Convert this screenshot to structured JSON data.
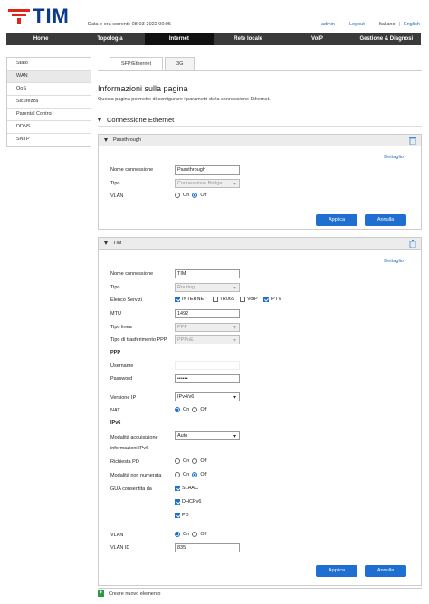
{
  "header": {
    "brand": "TIM",
    "date_label": "Data e ora correnti: 08-03-2022 00:05",
    "user": "admin",
    "logout": "Logout",
    "lang_it": "Italiano",
    "lang_sep": "|",
    "lang_en": "English"
  },
  "nav": {
    "items": [
      "Home",
      "Topologia",
      "Internet",
      "Rete locale",
      "VoIP",
      "Gestione & Diagnosi"
    ]
  },
  "sidebar": {
    "items": [
      "Stato",
      "WAN",
      "QoS",
      "Sicurezza",
      "Parental Control",
      "DDNS",
      "SNTP"
    ]
  },
  "tabs": [
    "SFP/Ethernet",
    "3G"
  ],
  "page": {
    "title": "Informazioni sulla pagina",
    "description": "Questa pagina permette di configurare i parametri della connessione Ethernet.",
    "section": "Connessione Ethernet"
  },
  "panel1": {
    "header": "Passthrough",
    "detail_link": "Dettaglio",
    "name_label": "Nome connessione",
    "name_value": "Passthrough",
    "type_label": "Tipo",
    "type_value": "Connessione Bridge",
    "vlan_label": "VLAN",
    "on": "On",
    "off": "Off",
    "apply": "Applica",
    "cancel": "Annulla"
  },
  "panel2": {
    "header": "TIM",
    "detail_link": "Dettaglio",
    "name_label": "Nome connessione",
    "name_value": "TIM",
    "type_label": "Tipo",
    "type_value": "Routing",
    "services_label": "Elenco Servizi",
    "svc_internet": "INTERNET",
    "svc_tr069": "TR069",
    "svc_voip": "VoIP",
    "svc_iptv": "IPTV",
    "mtu_label": "MTU",
    "mtu_value": "1492",
    "line_label": "Tipo linea",
    "line_value": "PPP",
    "ppp_type_label": "Tipo di trasferimento PPP",
    "ppp_type_value": "PPPoE",
    "ppp_heading": "PPP",
    "username_label": "Username",
    "username_value": "",
    "password_label": "Password",
    "password_value": "••••••",
    "ipver_label": "Versione IP",
    "ipver_value": "IPv4/v6",
    "nat_label": "NAT",
    "ipv6_heading": "IPv6",
    "acq_label": "Modalità acquisizione",
    "acq_value": "Auto",
    "info_label": "informazioni IPv6",
    "pd_label": "Richiesta PD",
    "unnum_label": "Modalità non numerata",
    "gua_label": "GUA consentita da",
    "gua_slaac": "SLAAC",
    "gua_dhcp": "DHCPv6",
    "gua_pd": "PD",
    "vlan_label": "VLAN",
    "vlanid_label": "VLAN ID",
    "vlanid_value": "835",
    "on": "On",
    "off": "Off",
    "apply": "Applica",
    "cancel": "Annulla"
  },
  "footer": {
    "add_label": "Creare nuovo elemento"
  },
  "colors": {
    "brand": "#0a3a8c",
    "logo_red": "#e2231a",
    "accent": "#1f6fd0",
    "nav_bg": "#3a3a3a",
    "add_green": "#2a9a4a"
  }
}
